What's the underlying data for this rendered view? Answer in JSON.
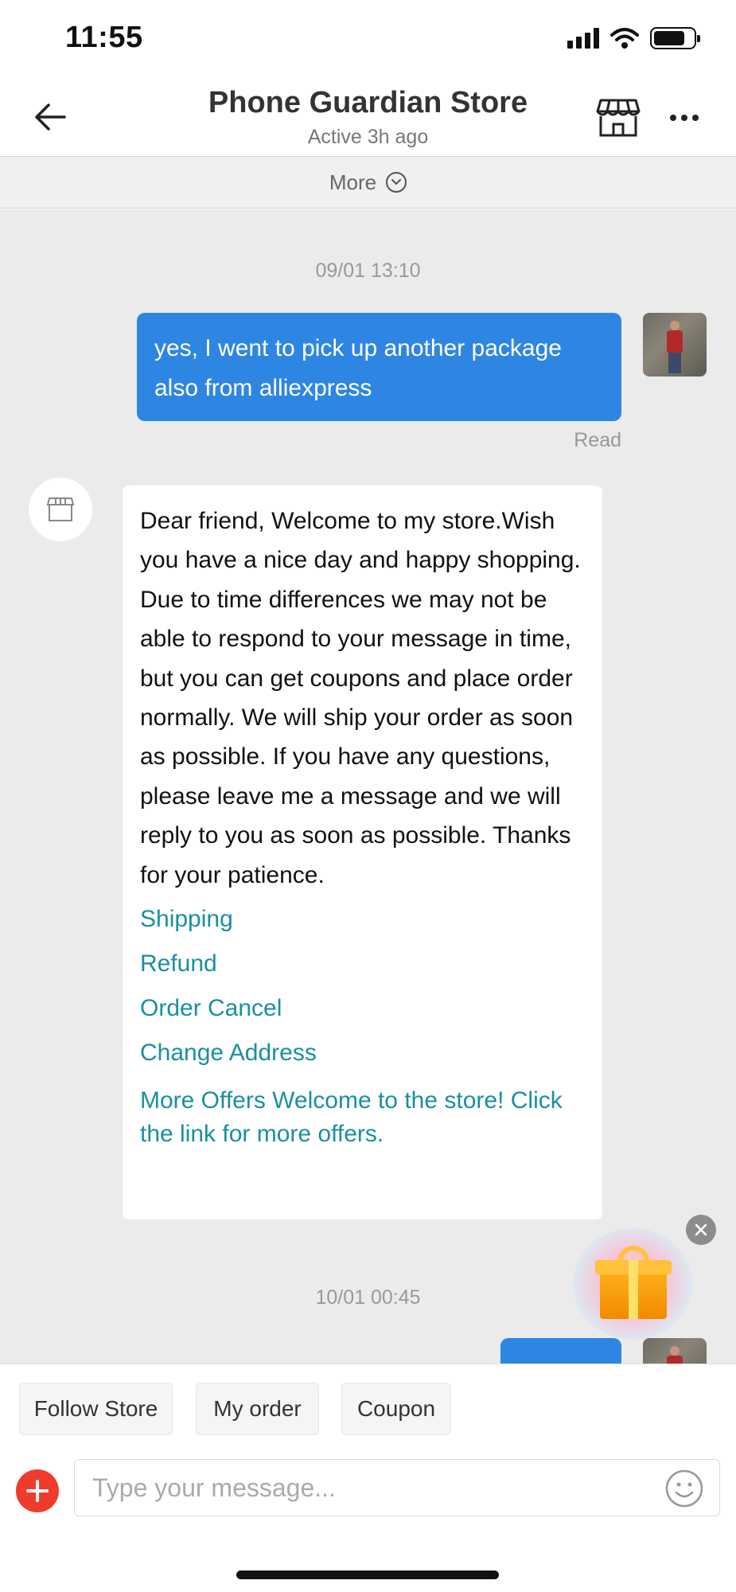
{
  "status_bar": {
    "time": "11:55"
  },
  "header": {
    "title": "Phone Guardian Store",
    "subtitle": "Active 3h ago"
  },
  "more_bar": {
    "label": "More"
  },
  "chat": {
    "timestamp_1": "09/01 13:10",
    "outgoing_message": "yes, I went to pick up another package also from alliexpress",
    "read_status": "Read",
    "incoming_message": "Dear friend, Welcome to my store.Wish you have a nice day and happy shopping. Due to time differences we may not be able to respond to your message in time, but you can get coupons and place order normally. We will ship your order as soon as possible. If you have any questions, please leave me a message and we will reply to you as soon as possible. Thanks for your patience.",
    "quick_links": [
      "Shipping",
      "Refund",
      "Order Cancel",
      "Change Address",
      "More Offers Welcome to the store! Click the link for more offers."
    ],
    "timestamp_2": "10/01 00:45"
  },
  "quick_actions": {
    "follow_store": "Follow Store",
    "my_order": "My order",
    "coupon": "Coupon"
  },
  "input": {
    "placeholder": "Type your message..."
  },
  "colors": {
    "outgoing_bubble": "#2e86e3",
    "link": "#1a8fa0",
    "plus_button": "#f03b2c",
    "chat_background": "#ebebeb"
  }
}
